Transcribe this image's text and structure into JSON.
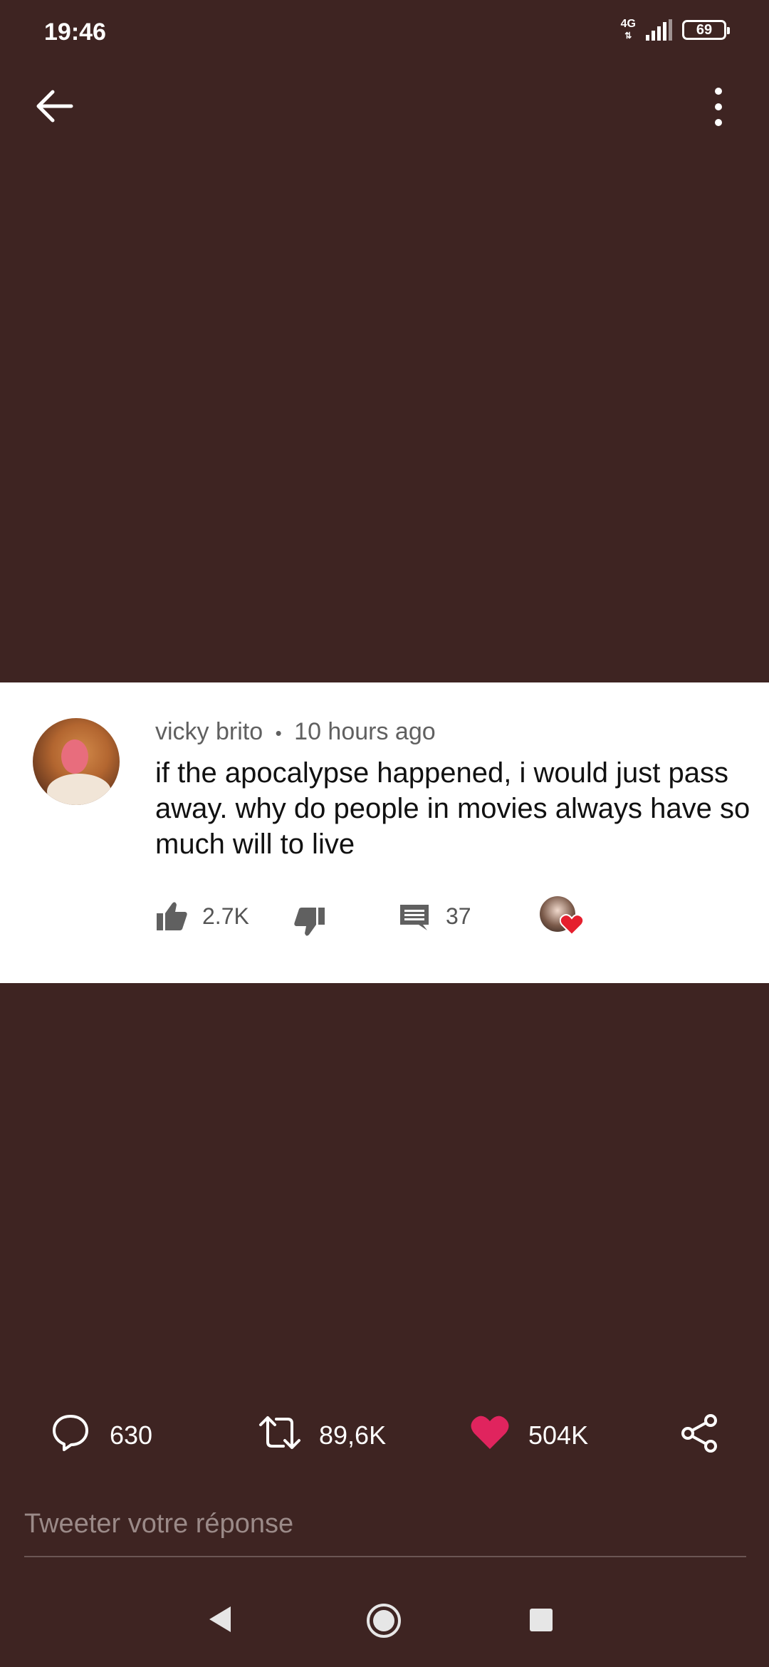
{
  "status_bar": {
    "time": "19:46",
    "network": "4G",
    "battery": "69"
  },
  "header": {
    "back_icon": "arrow-left-icon",
    "menu_icon": "more-vertical-icon"
  },
  "comment_card": {
    "author": "vicky brito",
    "separator": "•",
    "time_ago": "10 hours ago",
    "text": "if the apocalypse happened, i would just pass away. why do people in movies always have so much will to live",
    "likes": "2.7K",
    "replies": "37"
  },
  "tweet_actions": {
    "replies": "630",
    "retweets": "89,6K",
    "likes": "504K",
    "like_color": "#e0245e"
  },
  "reply_box": {
    "placeholder": "Tweeter votre réponse"
  },
  "colors": {
    "background": "#3e2422",
    "card": "#ffffff"
  }
}
